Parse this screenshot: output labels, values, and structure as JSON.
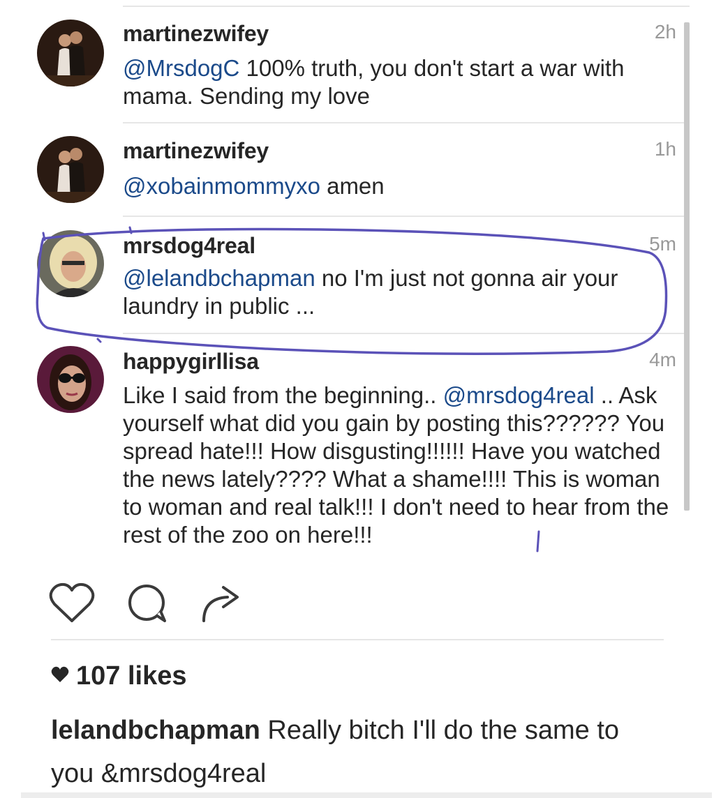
{
  "comments": [
    {
      "username": "martinezwifey",
      "time": "2h",
      "mention": "@MrsdogC",
      "text": " 100% truth, you don't start a war with mama. Sending my love",
      "avatar_icon": "couple-photo-avatar"
    },
    {
      "username": "martinezwifey",
      "time": "1h",
      "mention": "@xobainmommyxo",
      "text": " amen",
      "avatar_icon": "couple-photo-avatar"
    },
    {
      "username": "mrsdog4real",
      "time": "5m",
      "mention": "@lelandbchapman",
      "text": " no I'm just not gonna air your laundry in public ...",
      "avatar_icon": "blonde-woman-avatar"
    },
    {
      "username": "happygirllisa",
      "time": "4m",
      "text_pre": "Like I said from the beginning.. ",
      "mention": "@mrsdog4real",
      "text": " .. Ask yourself what did you gain by posting this?????? You spread hate!!! How disgusting!!!!!! Have you watched the news lately???? What a shame!!!! This is woman to woman and real talk!!! I don't need to hear from the rest of the zoo on here!!!",
      "avatar_icon": "sunglasses-woman-avatar"
    }
  ],
  "actions": {
    "like_icon": "heart-outline-icon",
    "comment_icon": "comment-bubble-icon",
    "share_icon": "share-arrow-icon"
  },
  "likes": {
    "count_text": "107 likes",
    "icon": "filled-heart-icon"
  },
  "caption": {
    "username": "lelandbchapman",
    "text": " Really bitch I'll do the same to you &mrsdog4real"
  },
  "colors": {
    "mention": "#1b4a8a",
    "annotation": "#5b52b8",
    "timestamp": "#999999"
  }
}
